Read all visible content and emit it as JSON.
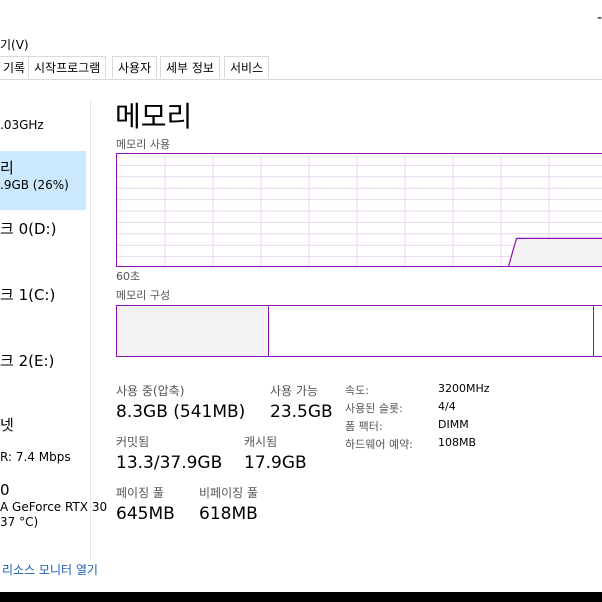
{
  "window": {
    "minimize_glyph": "-",
    "menu": {
      "view": "보기(V)",
      "view_visible": "기(V)"
    }
  },
  "tabs": [
    {
      "label": "기록"
    },
    {
      "label": "시작프로그램"
    },
    {
      "label": "사용자"
    },
    {
      "label": "세부 정보"
    },
    {
      "label": "서비스"
    }
  ],
  "sidebar": {
    "cpu_freq": ".03GHz",
    "memory": {
      "title": "리",
      "detail": ".9GB (26%)"
    },
    "disk0": {
      "title": "크 0(D:)"
    },
    "disk1": {
      "title": "크 1(C:)"
    },
    "disk2": {
      "title": "크 2(E:)"
    },
    "ethernet": {
      "title": "넷",
      "detail": "R: 7.4 Mbps"
    },
    "gpu": {
      "title": "0",
      "detail": "A GeForce RTX 30",
      "temp": "37 °C)"
    }
  },
  "main": {
    "title": "메모리",
    "usage_label": "메모리 사용",
    "time_label": "60초",
    "composition_label": "메모리 구성"
  },
  "stats": {
    "in_use_label": "사용 중(압축)",
    "in_use_value": "8.3GB (541MB)",
    "available_label": "사용 가능",
    "available_value": "23.5GB",
    "committed_label": "커밋됨",
    "committed_value": "13.3/37.9GB",
    "cached_label": "캐시됨",
    "cached_value": "17.9GB",
    "paged_label": "페이징 풀",
    "paged_value": "645MB",
    "nonpaged_label": "비페이징 풀",
    "nonpaged_value": "618MB"
  },
  "details": [
    {
      "label": "속도:",
      "value": "3200MHz"
    },
    {
      "label": "사용된 슬롯:",
      "value": "4/4"
    },
    {
      "label": "폼 팩터:",
      "value": "DIMM"
    },
    {
      "label": "하드웨어 예약:",
      "value": "108MB"
    }
  ],
  "footer": {
    "link": "리소스 모니터 열기"
  },
  "colors": {
    "accent": "#8b12ae",
    "selected": "#cce8ff",
    "grid": "#e8d7ee"
  },
  "chart_data": {
    "type": "area",
    "title": "메모리 사용",
    "xlabel": "60초",
    "values_percent": [
      0,
      0,
      0,
      0,
      0,
      0,
      0,
      0,
      0,
      0,
      0,
      0,
      0,
      0,
      0,
      0,
      0,
      0,
      0,
      0,
      0,
      0,
      0,
      0,
      0,
      0,
      0,
      0,
      0,
      0,
      0,
      0,
      0,
      0,
      0,
      0,
      0,
      0,
      0,
      0,
      0,
      0,
      0,
      0,
      0,
      0,
      0,
      26,
      26,
      26,
      26,
      26,
      26,
      26,
      26,
      26,
      26,
      26,
      26,
      26,
      26
    ],
    "ylim": [
      0,
      100
    ]
  },
  "composition": {
    "in_use_fraction": 0.31
  }
}
